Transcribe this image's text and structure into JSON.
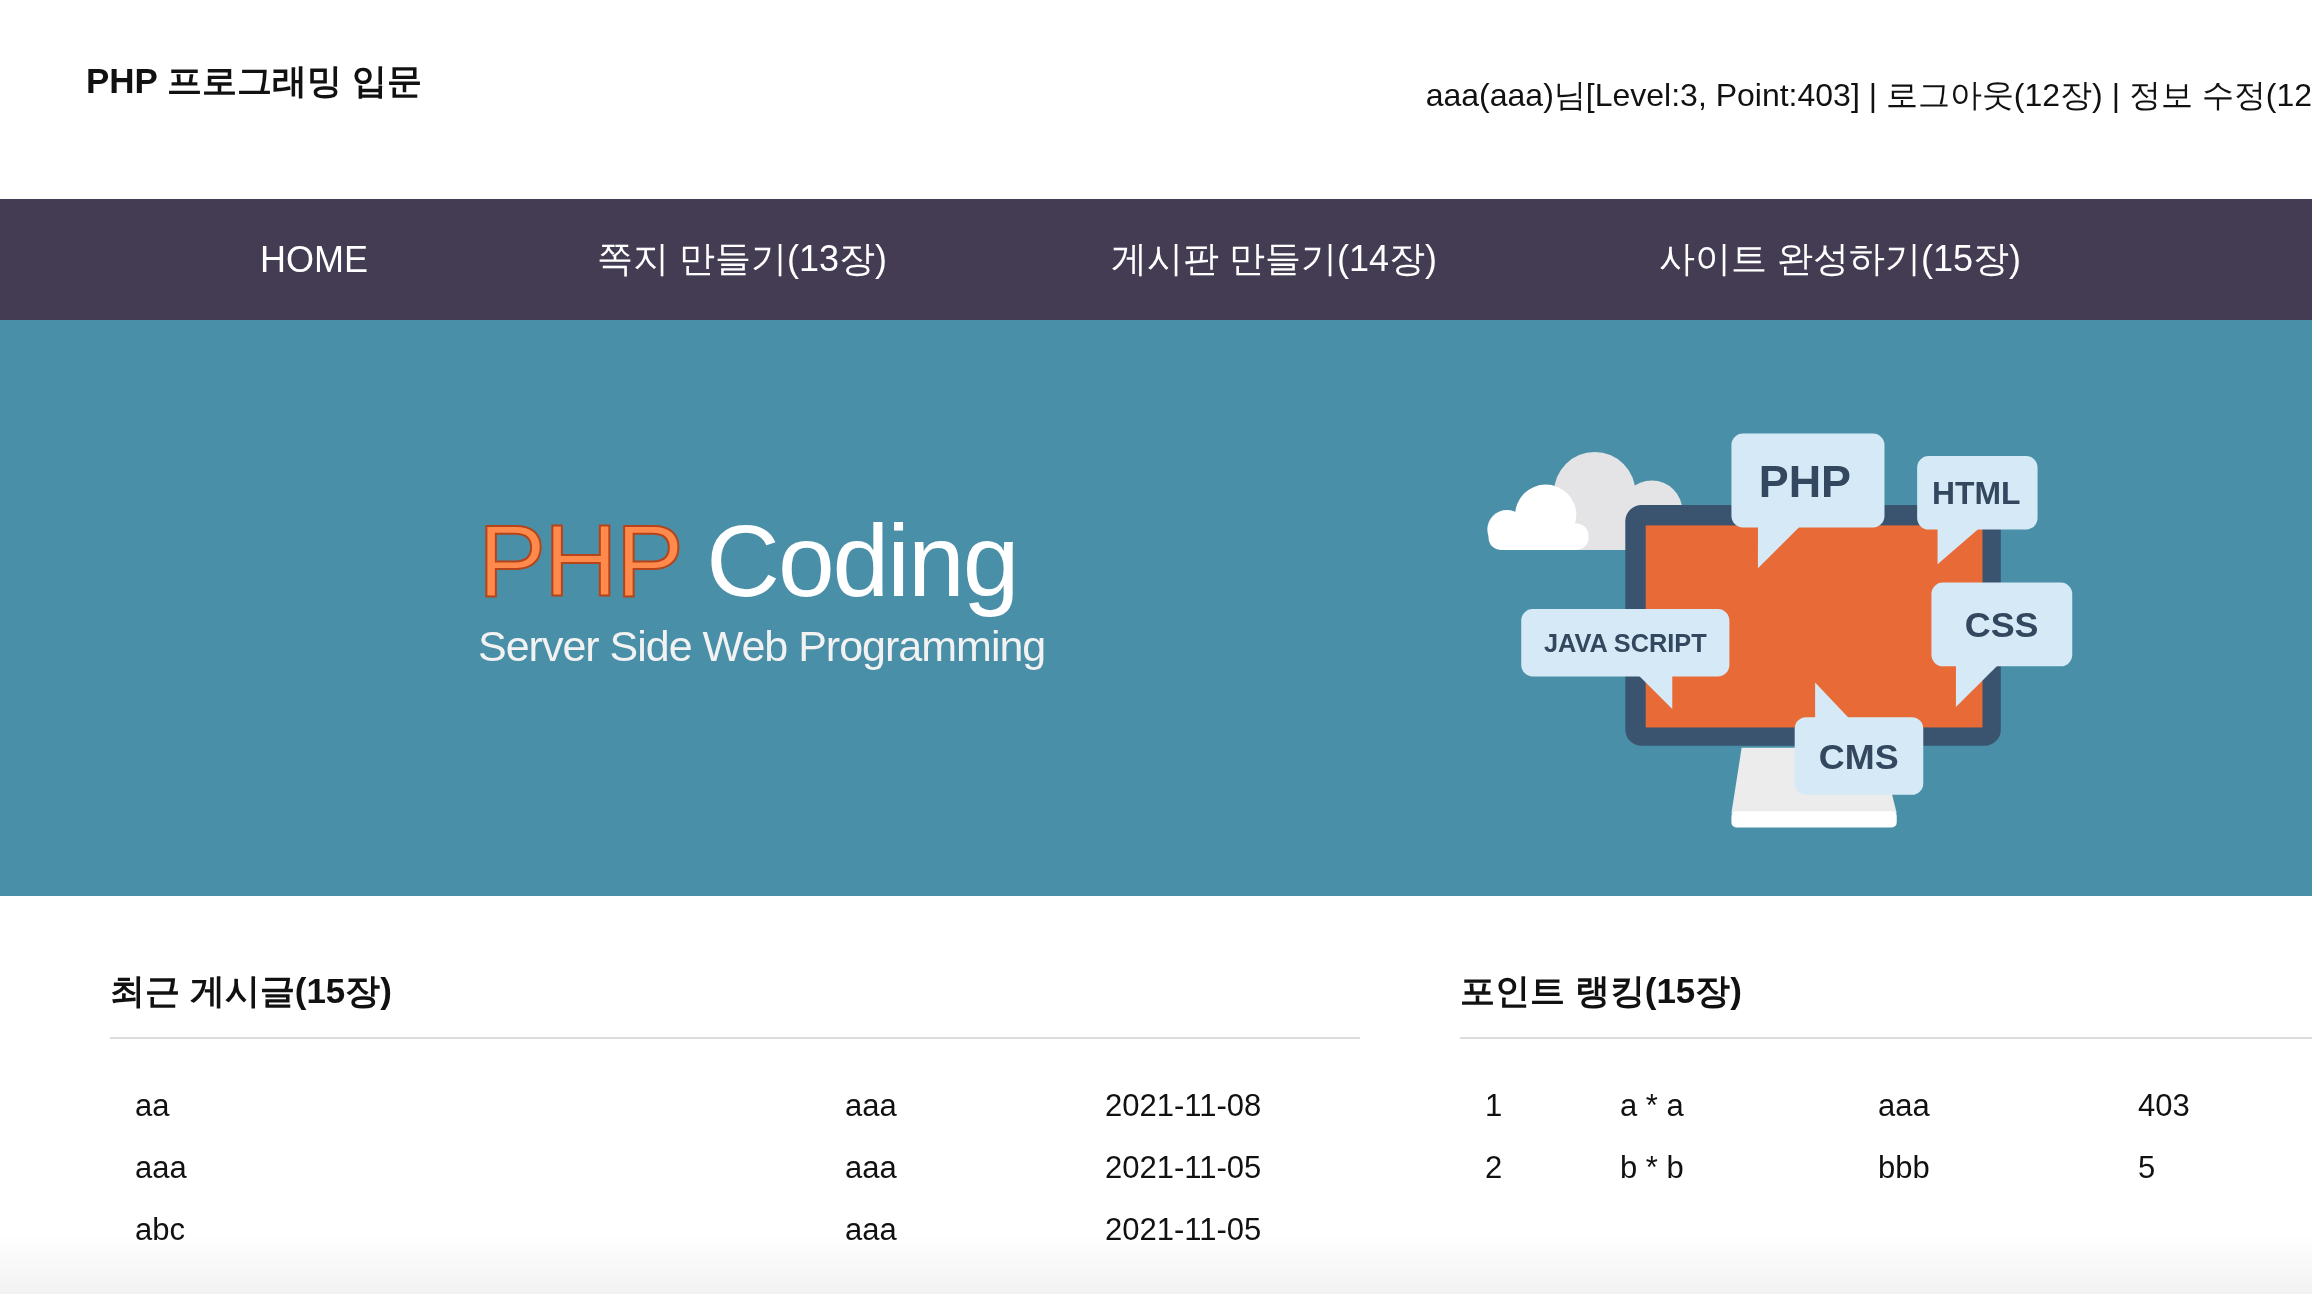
{
  "header": {
    "title": "PHP 프로그래밍 입문",
    "user_info": "aaa(aaa)님[Level:3, Point:403] | 로그아웃(12장) | 정보 수정(12"
  },
  "nav": [
    {
      "label": "HOME"
    },
    {
      "label": "쪽지 만들기(13장)"
    },
    {
      "label": "게시판 만들기(14장)"
    },
    {
      "label": "사이트 완성하기(15장)"
    }
  ],
  "banner": {
    "logo_highlight": "PHP",
    "logo_text": "Coding",
    "tagline": "Server Side Web Programming",
    "bubbles": [
      "PHP",
      "HTML",
      "JAVA SCRIPT",
      "CSS",
      "CMS"
    ]
  },
  "recent_posts": {
    "title": "최근 게시글(15장)",
    "rows": [
      [
        "aa",
        "aaa",
        "2021-11-08"
      ],
      [
        "aaa",
        "aaa",
        "2021-11-05"
      ],
      [
        "abc",
        "aaa",
        "2021-11-05"
      ]
    ]
  },
  "point_ranking": {
    "title": "포인트 랭킹(15장)",
    "rows": [
      [
        "1",
        "a * a",
        "aaa",
        "403"
      ],
      [
        "2",
        "b * b",
        "bbb",
        "5"
      ]
    ]
  }
}
